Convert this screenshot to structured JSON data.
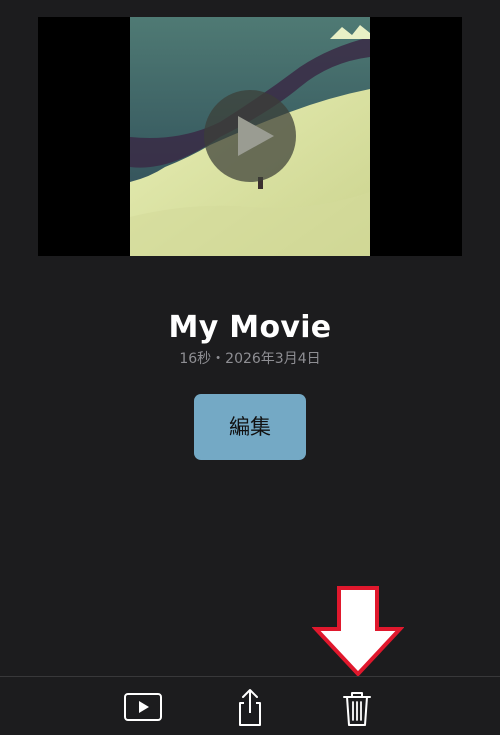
{
  "movie": {
    "title": "My Movie",
    "meta": "16秒・2026年3月4日"
  },
  "actions": {
    "edit_label": "編集"
  },
  "icons": {
    "play_overlay": "play-icon",
    "toolbar_play": "play-rectangle-icon",
    "toolbar_share": "share-icon",
    "toolbar_delete": "trash-icon",
    "annotation": "down-arrow-icon"
  },
  "colors": {
    "background": "#1c1c1e",
    "edit_button": "#74a9c5",
    "annotation_arrow": "#e0182d",
    "secondary_text": "#8e8e93"
  }
}
